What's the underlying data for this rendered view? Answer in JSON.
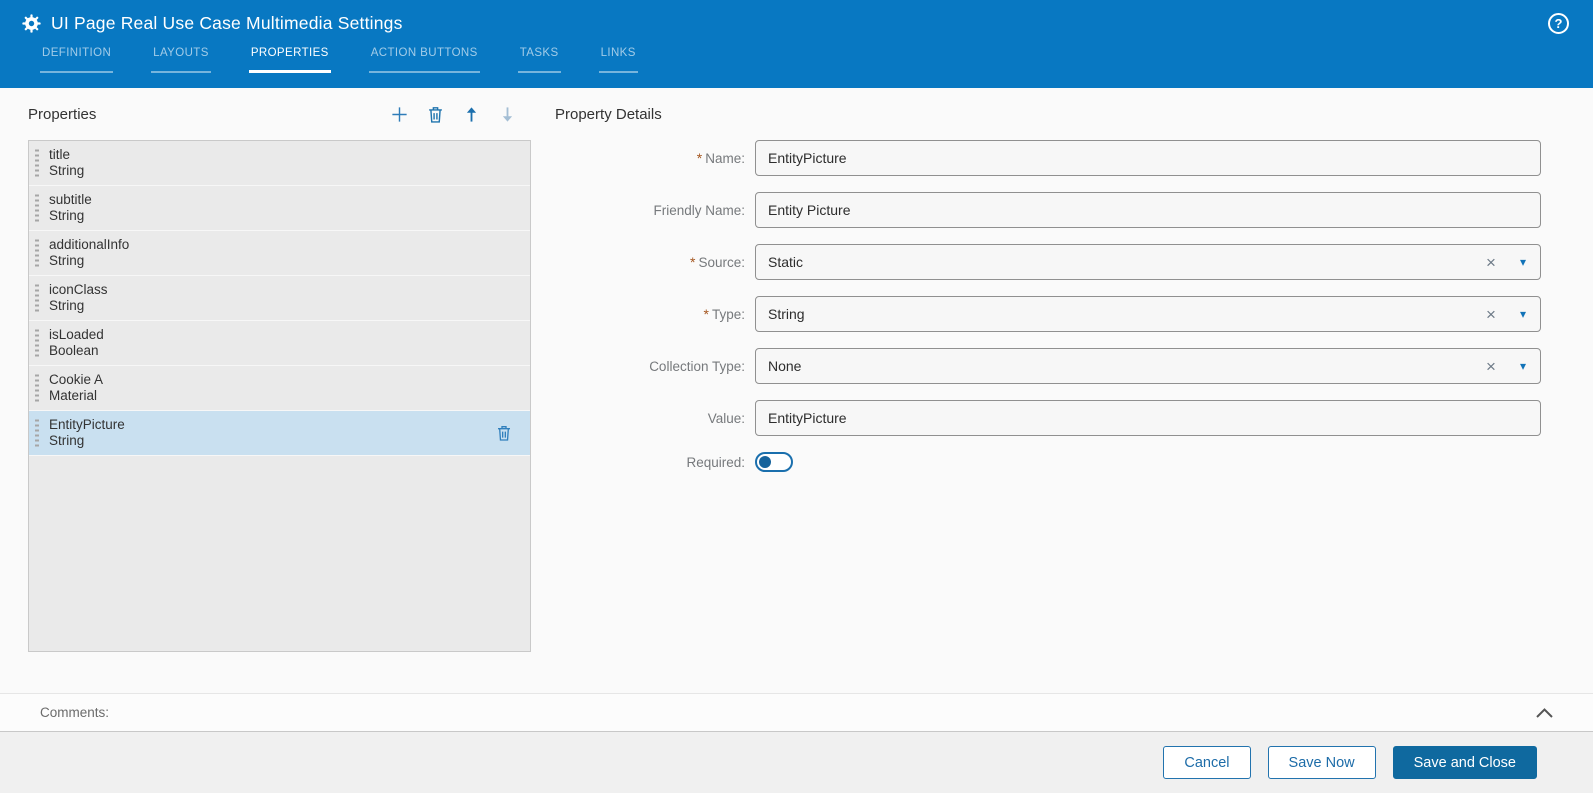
{
  "colors": {
    "header_bg": "#0878c2",
    "accent_blue": "#1a6fad",
    "selected_row_bg": "#c9e0f0",
    "primary_button_bg": "#0f699f",
    "required_marker": "#a4551e"
  },
  "header": {
    "title": "UI Page Real Use Case Multimedia Settings",
    "help_icon_glyph": "?",
    "active_tab": "PROPERTIES",
    "tabs": [
      {
        "label": "DEFINITION"
      },
      {
        "label": "LAYOUTS"
      },
      {
        "label": "PROPERTIES"
      },
      {
        "label": "ACTION BUTTONS"
      },
      {
        "label": "TASKS"
      },
      {
        "label": "LINKS"
      }
    ]
  },
  "properties_panel": {
    "title": "Properties",
    "toolbar": [
      "add",
      "delete",
      "move-up",
      "move-down"
    ],
    "items": [
      {
        "name": "title",
        "type": "String",
        "selected": false
      },
      {
        "name": "subtitle",
        "type": "String",
        "selected": false
      },
      {
        "name": "additionalInfo",
        "type": "String",
        "selected": false
      },
      {
        "name": "iconClass",
        "type": "String",
        "selected": false
      },
      {
        "name": "isLoaded",
        "type": "Boolean",
        "selected": false
      },
      {
        "name": "Cookie A",
        "type": "Material",
        "selected": false
      },
      {
        "name": "EntityPicture",
        "type": "String",
        "selected": true
      }
    ]
  },
  "details_panel": {
    "title": "Property Details",
    "required_marker": "*",
    "combo_icons": {
      "clear": "×",
      "caret": "▾"
    },
    "fields": {
      "name": {
        "label": "Name:",
        "value": "EntityPicture",
        "required": true
      },
      "friendly_name": {
        "label": "Friendly Name:",
        "value": "Entity Picture",
        "required": false
      },
      "source": {
        "label": "Source:",
        "value": "Static",
        "required": true
      },
      "type": {
        "label": "Type:",
        "value": "String",
        "required": true
      },
      "collection_type": {
        "label": "Collection Type:",
        "value": "None",
        "required": false
      },
      "value": {
        "label": "Value:",
        "value": "EntityPicture",
        "required": false
      },
      "required": {
        "label": "Required:",
        "state": "off"
      }
    }
  },
  "comments": {
    "label": "Comments:"
  },
  "footer": {
    "cancel": "Cancel",
    "save_now": "Save Now",
    "save_and_close": "Save and Close"
  }
}
